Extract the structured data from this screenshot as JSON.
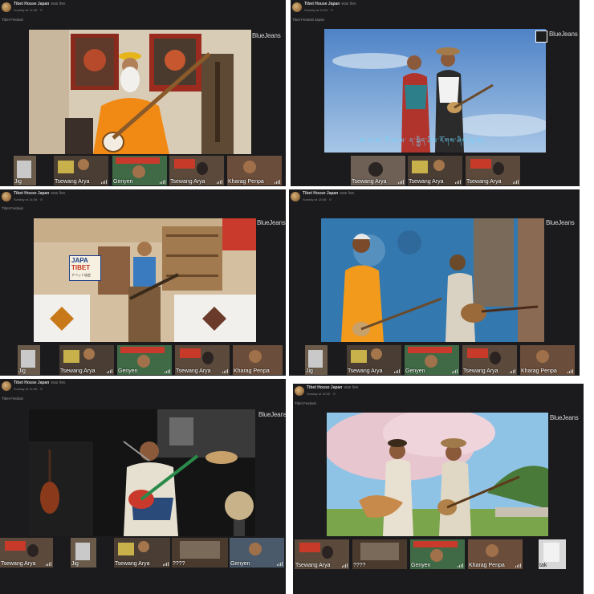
{
  "page_name": "Tibet House Japan",
  "brand": "BlueJeans",
  "panels": [
    {
      "header": {
        "page_name": "Tibet House Japan",
        "suffix": "was live.",
        "time": "Sunday at 14:08 · ⊙"
      },
      "label": "Tibet Festival",
      "participants": [
        "Jig",
        "Tsewang Arya",
        "Genyen",
        "Tsewang Arya",
        "Kharag Penpa"
      ]
    },
    {
      "header": {
        "page_name": "Tibet House Japan",
        "suffix": "was live.",
        "time": "Sunday at 15:03 · ⊙"
      },
      "label": "Tibet Festival Japan",
      "subtitle": "ཨ་ཡ་མ་ རི་ལ་ལ་ ད་སྐྱིད་ཤིས་རོགས་ཞིག་ལུ་མ།",
      "participants": [
        "Tsewang Arya",
        "Tsewang Arya",
        "Tsewang Arya"
      ]
    },
    {
      "header": {
        "page_name": "Tibet House Japan",
        "suffix": "was live.",
        "time": "Sunday at 14:08 · ⊙"
      },
      "label": "Tibet Festival",
      "sign": [
        "JAPA",
        "TIBET",
        "チベット協会"
      ],
      "participants": [
        "Jig",
        "Tsewang Arya",
        "Genyen",
        "Tsewang Arya",
        "Kharag Penpa"
      ]
    },
    {
      "header": {
        "page_name": "Tibet House Japan",
        "suffix": "was live.",
        "time": "Sunday at 14:08 · ⊙"
      },
      "label": "",
      "participants": [
        "Jig",
        "Tsewang Arya",
        "Genyen",
        "Tsewang Arya",
        "Kharag Penpa"
      ]
    },
    {
      "header": {
        "page_name": "Tibet House Japan",
        "suffix": "was live.",
        "time": "Sunday at 14:08 · ⊙"
      },
      "label": "Tibet Festival",
      "participants": [
        "Tsewang Arya",
        "Jig",
        "Tsewang Arya",
        "????",
        "Genyen"
      ]
    },
    {
      "header": {
        "page_name": "Tibet House Japan",
        "suffix": "was live.",
        "time": "Sunday at 15:00 · ⊙"
      },
      "label": "Tibet Festival",
      "participants": [
        "Tsewang Arya",
        "????",
        "Genyen",
        "Kharag Penpa",
        "tak"
      ]
    }
  ],
  "colors": {
    "panel_bg": "#1b1b1d",
    "brand_text": "#d6d6d6",
    "name_text": "#ffffff",
    "subtitle": "#6fd6ff"
  }
}
